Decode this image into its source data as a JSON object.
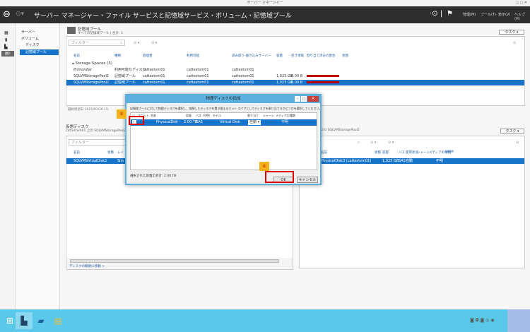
{
  "window": {
    "title": "サーバー マネージャー"
  },
  "header": {
    "breadcrumb": "サーバー マネージャー・ファイル サービスと記憶域サービス・ボリューム・記憶域プール",
    "menus": [
      "管理(M)",
      "ツール(T)",
      "表示(V)",
      "ヘルプ(H)"
    ]
  },
  "nav": {
    "items": [
      "サーバー",
      "ボリューム",
      "ディスク",
      "記憶域プール"
    ],
    "selected": "記憶域プール"
  },
  "pools": {
    "title": "記憶域プール",
    "subtitle": "すべての記憶域プール | 合計: 3",
    "tasks": "タスク",
    "filter_placeholder": "フィルター",
    "columns": [
      "名前",
      "種類",
      "管理者",
      "利用可能",
      "読み取り-書き込みサーバー",
      "容量",
      "空き領域",
      "割り当て済みの割合",
      "状態"
    ],
    "group": "Storage Spaces (3)",
    "rows": [
      {
        "name": "Primordial",
        "type": "利用可能なディスク",
        "manager": "cattestvm01",
        "available": "cattestvm01",
        "rw": "cattestvm01",
        "capacity": "",
        "free": "",
        "alloc": null
      },
      {
        "name": "SQLVMStoragePool1",
        "type": "記憶域プール",
        "manager": "cattestvm01",
        "available": "cattestvm01",
        "rw": "cattestvm01",
        "capacity": "1,023 GB",
        "free": "0.00 B",
        "alloc": 100
      },
      {
        "name": "SQLVMStoragePool2",
        "type": "記憶域プール",
        "manager": "cattestvm01",
        "available": "cattestvm01",
        "rw": "cattestvm01",
        "capacity": "1,023 GB",
        "free": "0.00 B",
        "alloc": 100
      }
    ],
    "updated": "最終更新日 2021/01/26 15:"
  },
  "vdisks": {
    "title": "仮想ディスク",
    "subtitle": "cattestvm01 上の SQLVMStoragePool2",
    "filter_placeholder": "フィルター",
    "columns": [
      "名前",
      "状態",
      "レイ"
    ],
    "rows": [
      {
        "name": "SQLVMVirtualDisk2",
        "status": "",
        "layout": "Sim"
      }
    ],
    "link": "ディスクの概要に移動 >"
  },
  "pdisks": {
    "subtitle": "2.0 SQLVMStoragePool2",
    "tasks": "タスク",
    "columns": [
      "名前",
      "状態",
      "容量",
      "バス",
      "使用状況",
      "シャーシ",
      "メディアの種類",
      "RPM"
    ],
    "rows": [
      {
        "name": "PhysicalDisk3 (cattestvm01)",
        "status": "",
        "capacity": "1,023 GB",
        "bus": "SAS",
        "usage": "自動",
        "chassis": "",
        "media": "不明",
        "rpm": ""
      }
    ]
  },
  "dialog": {
    "title": "物理ディスクの追加",
    "instruction": "記憶域プールに対して物理ディスクを選択し、故障したディスクを置き換えるホット スペアとしてディスクを割り当てるかどうかを選択してください。",
    "columns": [
      "スロット",
      "名前",
      "容量",
      "バス",
      "RPM",
      "モデル",
      "割り当て",
      "シャーシ",
      "メディアの種類"
    ],
    "rows": [
      {
        "checked": true,
        "slot": "",
        "name": "PhysicalDisk -",
        "capacity": "2.00 TB",
        "bus": "SAS",
        "rpm": "",
        "model": "Virtual Disk",
        "allocation": "自動",
        "chassis": "",
        "media": "不明"
      }
    ],
    "total_label": "選択された容量の合計:",
    "total": "2.00 TB",
    "ok": "OK",
    "cancel": "キャンセル"
  },
  "callouts": [
    "⑤",
    "⑥"
  ],
  "colors": {
    "accent": "#1874c9",
    "header": "#2e2e2e",
    "taskbar": "#5ac8e8",
    "highlight": "#e00000"
  }
}
